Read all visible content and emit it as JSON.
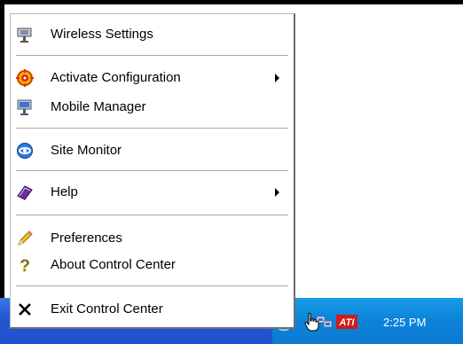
{
  "menu": {
    "items": [
      {
        "label": "Wireless Settings",
        "icon": "wireless-settings-icon"
      },
      {
        "label": "Activate Configuration",
        "icon": "activate-configuration-icon",
        "submenu": true
      },
      {
        "label": "Mobile Manager",
        "icon": "mobile-manager-icon"
      },
      {
        "label": "Site Monitor",
        "icon": "site-monitor-icon"
      },
      {
        "label": "Help",
        "icon": "help-book-icon",
        "submenu": true
      },
      {
        "label": "Preferences",
        "icon": "pencil-icon"
      },
      {
        "label": "About Control Center",
        "icon": "question-mark-icon"
      },
      {
        "label": "Exit Control Center",
        "icon": "close-x-icon"
      }
    ]
  },
  "taskbar": {
    "clock": "2:25 PM",
    "tray_icons": [
      "show-hidden-icons-chevron-icon",
      "network-icon",
      "ati-icon"
    ],
    "colors": {
      "taskbar": "#2457d4",
      "tray": "#0b84da"
    }
  }
}
